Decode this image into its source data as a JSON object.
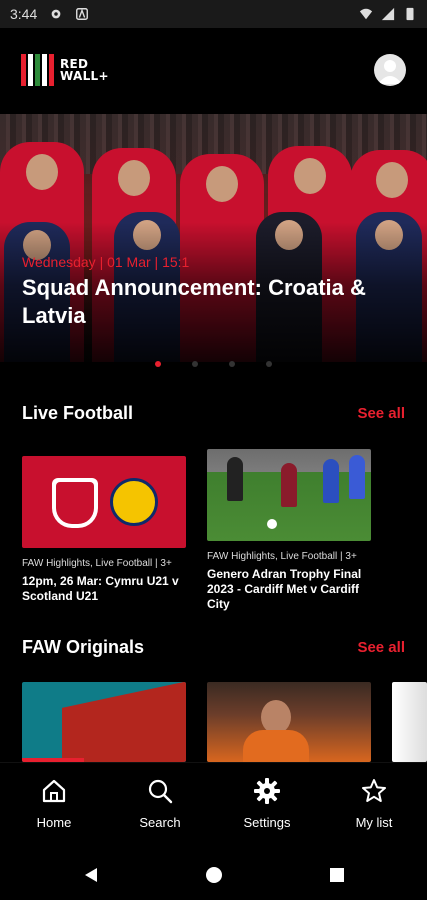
{
  "status_bar": {
    "time": "3:44",
    "icons": [
      "gear-icon",
      "font-icon",
      "wifi-icon",
      "signal-icon",
      "battery-icon"
    ]
  },
  "header": {
    "logo_text_line1": "RED",
    "logo_text_line2": "WALL+",
    "logo_colors": [
      "#e8202f",
      "#ffffff",
      "#2e8b3a",
      "#ffffff",
      "#e8202f"
    ],
    "profile_icon": "avatar-icon"
  },
  "hero": {
    "date": "Wednesday | 01 Mar | 15:1",
    "title": "Squad Announcement: Croatia & Latvia",
    "slides": 4,
    "active_slide": 1
  },
  "sections": {
    "live": {
      "title": "Live Football",
      "see_all": "See all",
      "cards": [
        {
          "meta": "FAW Highlights, Live Football | 3+",
          "title": "12pm, 26 Mar: Cymru U21 v Scotland U21"
        },
        {
          "meta": "FAW Highlights, Live Football | 3+",
          "title": "Genero Adran Trophy Final 2023 - Cardiff Met v Cardiff City"
        }
      ]
    },
    "originals": {
      "title": "FAW Originals",
      "see_all": "See all"
    }
  },
  "bottom_nav": {
    "items": [
      {
        "label": "Home",
        "icon": "home-icon"
      },
      {
        "label": "Search",
        "icon": "search-icon"
      },
      {
        "label": "Settings",
        "icon": "gear-icon"
      },
      {
        "label": "My list",
        "icon": "star-icon"
      }
    ],
    "active": "Home"
  },
  "system_nav": {
    "icons": [
      "back-icon",
      "home-circle-icon",
      "recents-icon"
    ]
  },
  "colors": {
    "accent": "#e8202f",
    "background": "#000000",
    "text": "#ffffff"
  }
}
